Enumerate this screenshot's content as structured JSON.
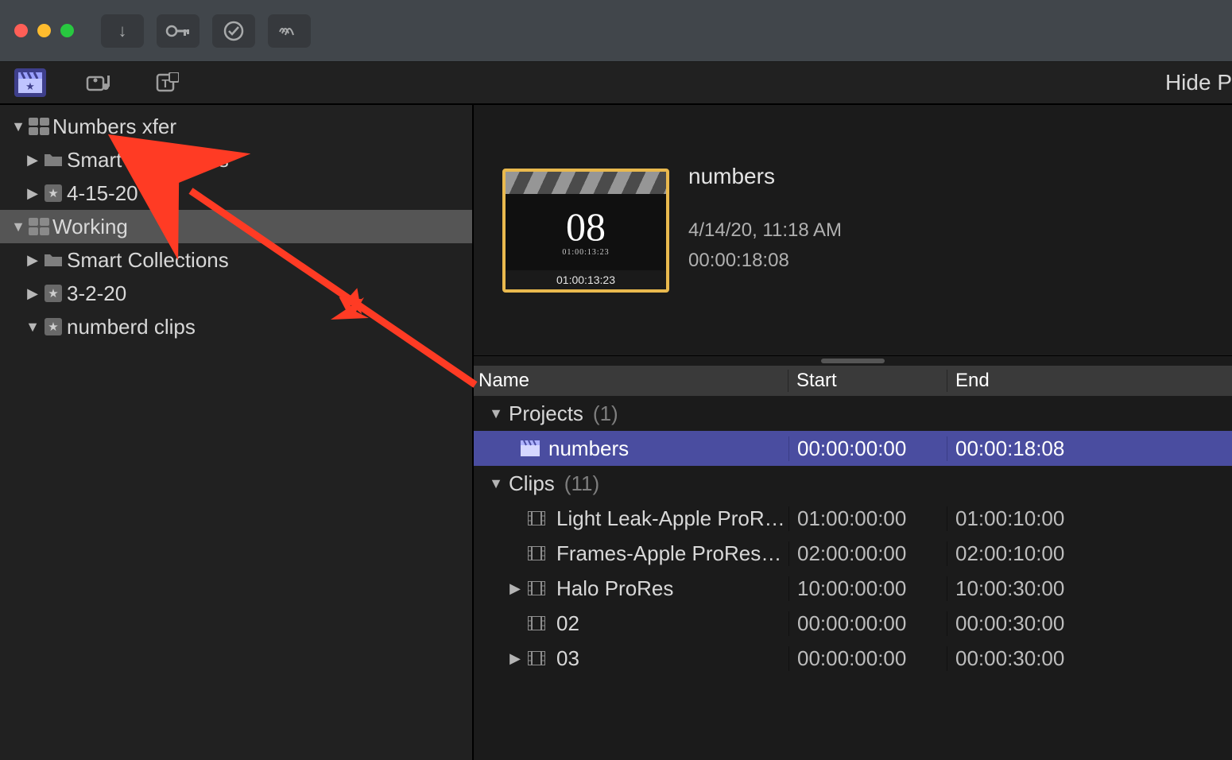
{
  "toolbar2": {
    "hide_label": "Hide P"
  },
  "sidebar": [
    {
      "indent": 0,
      "disc": "down",
      "icon": "library",
      "label": "Numbers xfer"
    },
    {
      "indent": 1,
      "disc": "right",
      "icon": "folder",
      "label": "Smart Collections"
    },
    {
      "indent": 1,
      "disc": "right",
      "icon": "star",
      "label": "4-15-20"
    },
    {
      "indent": 0,
      "disc": "down",
      "icon": "library",
      "label": "Working",
      "selected": true
    },
    {
      "indent": 1,
      "disc": "right",
      "icon": "folder",
      "label": "Smart Collections"
    },
    {
      "indent": 1,
      "disc": "right",
      "icon": "star",
      "label": "3-2-20"
    },
    {
      "indent": 1,
      "disc": "down",
      "icon": "star",
      "label": "numberd clips"
    }
  ],
  "clip": {
    "big": "08",
    "sub": "01:00:13:23",
    "foot": "01:00:13:23",
    "title": "numbers",
    "date": "4/14/20, 11:18 AM",
    "duration": "00:00:18:08"
  },
  "table": {
    "columns": {
      "name": "Name",
      "start": "Start",
      "end": "End"
    },
    "groups": [
      {
        "label": "Projects",
        "count": "(1)",
        "expanded": true
      },
      {
        "label": "Clips",
        "count": "(11)",
        "expanded": true
      }
    ],
    "project": {
      "name": "numbers",
      "start": "00:00:00:00",
      "end": "00:00:18:08"
    },
    "clips": [
      {
        "disc": "",
        "name": "Light Leak-Apple ProR…",
        "start": "01:00:00:00",
        "end": "01:00:10:00"
      },
      {
        "disc": "",
        "name": "Frames-Apple ProRes…",
        "start": "02:00:00:00",
        "end": "02:00:10:00"
      },
      {
        "disc": "right",
        "name": "Halo ProRes",
        "start": "10:00:00:00",
        "end": "10:00:30:00"
      },
      {
        "disc": "",
        "name": "02",
        "start": "00:00:00:00",
        "end": "00:00:30:00"
      },
      {
        "disc": "right",
        "name": "03",
        "start": "00:00:00:00",
        "end": "00:00:30:00"
      }
    ]
  }
}
